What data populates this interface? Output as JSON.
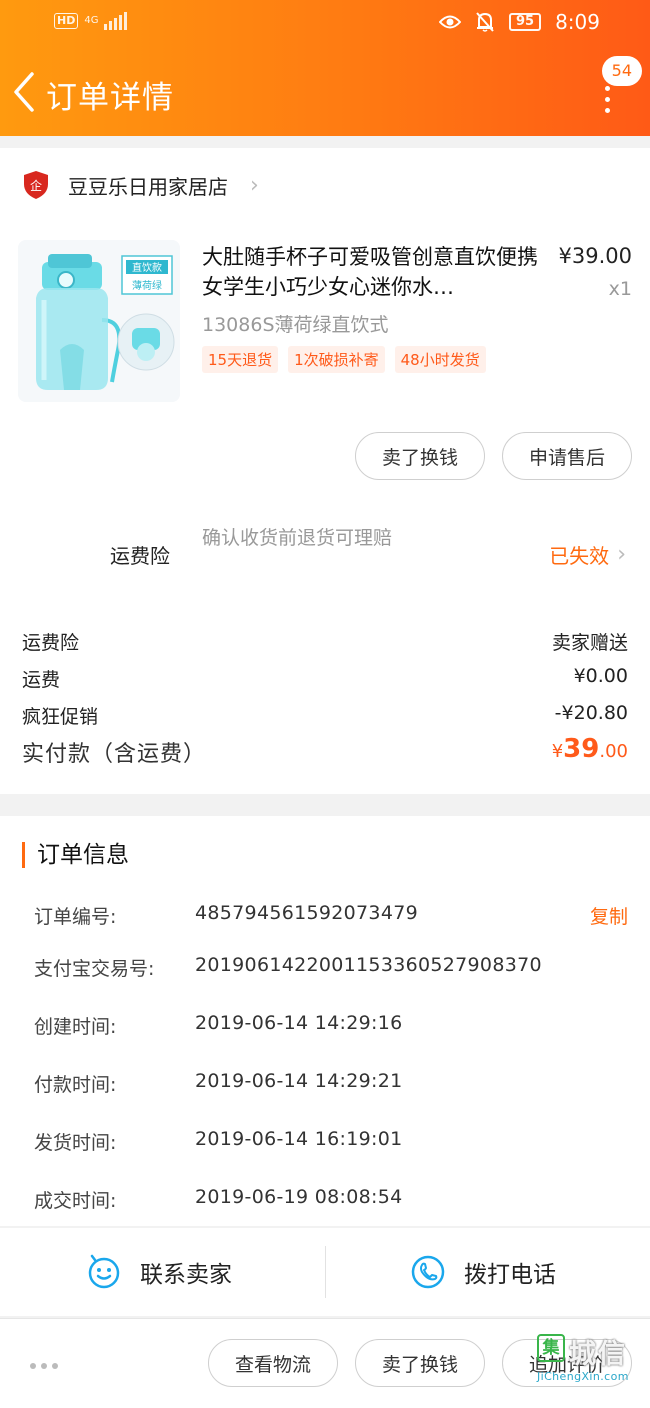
{
  "status_bar": {
    "hd": "HD",
    "network": "4G",
    "battery": "95",
    "time": "8:09"
  },
  "header": {
    "title": "订单详情",
    "message_count": "54"
  },
  "store": {
    "name": "豆豆乐日用家居店"
  },
  "product": {
    "title": "大肚随手杯子可爱吸管创意直饮便携女学生小巧少女心迷你水…",
    "price": "¥39.00",
    "quantity": "x1",
    "sku": "13086S薄荷绿直饮式",
    "tags": [
      "15天退货",
      "1次破损补寄",
      "48小时发货"
    ],
    "image_labels": [
      "直饮款",
      "薄荷绿"
    ]
  },
  "item_actions": {
    "sell": "卖了换钱",
    "after_sale": "申请售后"
  },
  "insurance": {
    "label": "运费险",
    "desc": "确认收货前退货可理赔",
    "status": "已失效"
  },
  "fees": [
    {
      "label": "运费险",
      "value": "卖家赠送"
    },
    {
      "label": "运费",
      "value": "¥0.00"
    },
    {
      "label": "疯狂促销",
      "value": "-¥20.80"
    }
  ],
  "total": {
    "label": "实付款（含运费）",
    "currency": "¥",
    "integer": "39",
    "decimal": ".00"
  },
  "order_info": {
    "title": "订单信息",
    "copy": "复制",
    "rows": [
      {
        "label": "订单编号:",
        "value": "485794561592073479"
      },
      {
        "label": "支付宝交易号:",
        "value": "2019061422001153360527908370"
      },
      {
        "label": "创建时间:",
        "value": "2019-06-14 14:29:16"
      },
      {
        "label": "付款时间:",
        "value": "2019-06-14 14:29:21"
      },
      {
        "label": "发货时间:",
        "value": "2019-06-14 16:19:01"
      },
      {
        "label": "成交时间:",
        "value": "2019-06-19 08:08:54"
      }
    ]
  },
  "contact": {
    "seller": "联系卖家",
    "call": "拨打电话"
  },
  "bottom_actions": {
    "logistics": "查看物流",
    "sell": "卖了换钱",
    "review": "追加评价"
  },
  "watermark": {
    "icon": "集",
    "text": "城信",
    "url": "JiChengXin.com"
  },
  "colors": {
    "accent": "#ff6a10",
    "header_start": "#ff9a0f",
    "header_end": "#ff5a16",
    "product_teal": "#4fd0df"
  }
}
